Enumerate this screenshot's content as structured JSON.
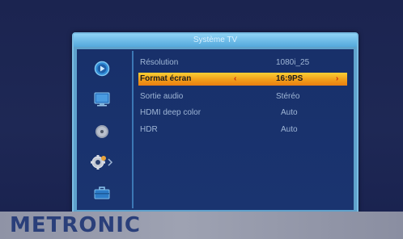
{
  "panel": {
    "title": "Système TV"
  },
  "menu": {
    "items": [
      {
        "label": "Résolution",
        "value": "1080i_25",
        "selected": false
      },
      {
        "label": "Format écran",
        "value": "16:9PS",
        "selected": true
      },
      {
        "label": "Sortie audio",
        "value": "Stéréo",
        "selected": false
      },
      {
        "label": "HDMI deep color",
        "value": "Auto",
        "selected": false
      },
      {
        "label": "HDR",
        "value": "Auto",
        "selected": false
      }
    ],
    "left_arrow": "‹",
    "right_arrow": "›"
  },
  "sidebar": {
    "icons": [
      "play-icon",
      "monitor-icon",
      "disc-icon",
      "settings-gear-icon",
      "briefcase-icon"
    ]
  },
  "brand": {
    "name": "METRONIC"
  },
  "colors": {
    "panel_border": "#5fa2cc",
    "panel_inner": "#18306a",
    "selection": "#f2a21b",
    "menu_text": "#9fb6d6",
    "brand_text": "#2a3f7a"
  }
}
